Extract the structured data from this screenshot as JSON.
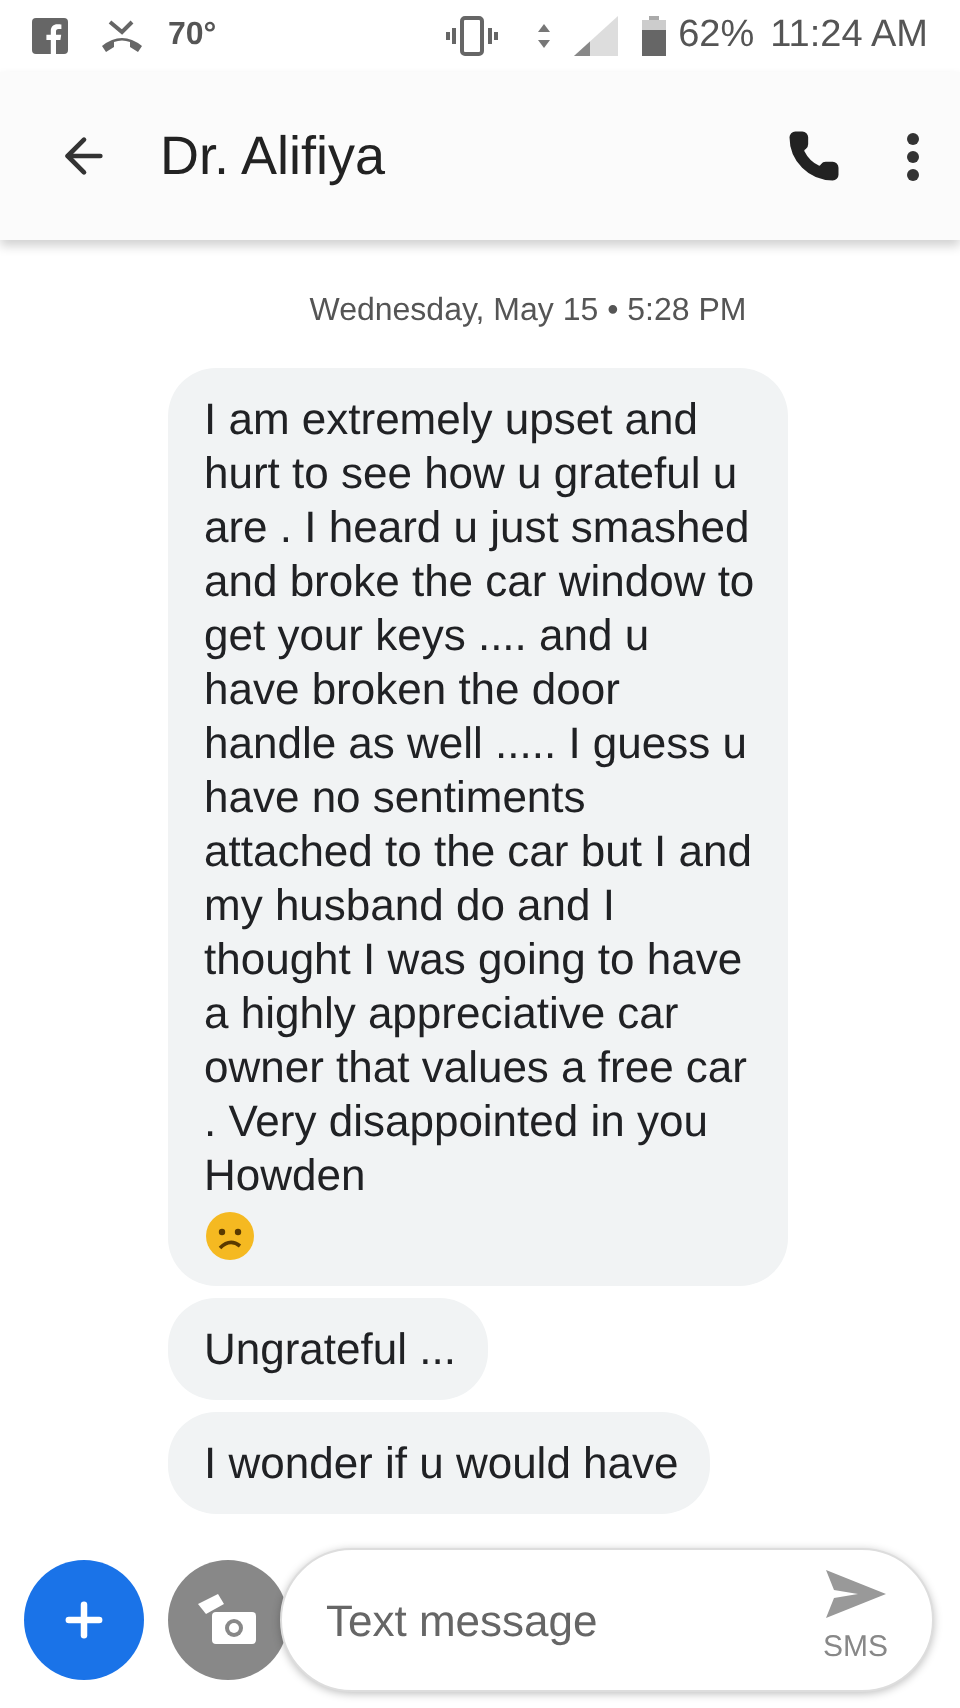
{
  "status_bar": {
    "temperature": "70°",
    "battery": "62%",
    "time": "11:24 AM"
  },
  "header": {
    "title": "Dr. Alifiya"
  },
  "date_divider": "Wednesday, May 15 • 5:28 PM",
  "messages": [
    {
      "text": "I am extremely upset and hurt to see how u grateful u are . I heard u just smashed and broke the car window to get your keys .... and u have broken the door handle as well ..... I guess u have no sentiments attached to the car but I and my husband do and I thought I was going to have a highly appreciative car owner that values a free car . Very disappointed in you Howden",
      "emoji": true
    },
    {
      "text": "Ungrateful ...",
      "emoji": false
    },
    {
      "text": "I wonder if u would have",
      "emoji": false
    }
  ],
  "compose": {
    "placeholder": "Text message",
    "send_label": "SMS"
  }
}
